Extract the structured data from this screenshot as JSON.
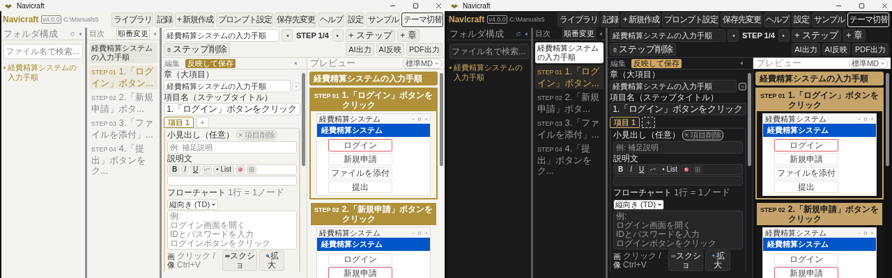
{
  "windows": [
    {
      "kind": "light",
      "title": "Navicraft",
      "app": {
        "brand": "Navicraft",
        "version": "v4.0.0",
        "path": "C:\\Manuals5"
      },
      "header_buttons": [
        {
          "label": "ライブラリ",
          "outlined": false
        },
        {
          "label": "記録",
          "outlined": false
        },
        {
          "label": "+ 新規作成",
          "outlined": false
        },
        {
          "label": "プロンプト設定",
          "outlined": false
        },
        {
          "label": "保存先変更",
          "outlined": false
        },
        {
          "label": "ヘルプ",
          "outlined": false
        },
        {
          "label": "設定",
          "outlined": false
        },
        {
          "label": "サンプル",
          "outlined": false
        },
        {
          "label": "テーマ切替",
          "outlined": true
        }
      ],
      "folder_panel": {
        "title": "フォルダ構成",
        "search": {
          "placeholder": "ファイル名で検索..."
        },
        "items": [
          "経費精算システムの入力手順"
        ]
      },
      "toc": {
        "title": "目次",
        "reorder_button": "順番変更",
        "items": [
          {
            "kind": "chapter",
            "label": "経費精算システムの入力手順",
            "selected": true
          },
          {
            "kind": "step",
            "step": "STEP 01",
            "label": "1.「ログイン」ボタン...",
            "selected": true
          },
          {
            "kind": "step",
            "step": "STEP 02",
            "label": "2.「新規申請」ボタ...",
            "selected": false
          },
          {
            "kind": "step",
            "step": "STEP 03",
            "label": "3.「ファイルを添付」...",
            "selected": false
          },
          {
            "kind": "step",
            "step": "STEP 04",
            "label": "4.「提出」ボタンをク...",
            "selected": false
          }
        ]
      },
      "toolbar": {
        "document_field": {
          "value": "経費精算システムの入力手順"
        },
        "step_indicator": "STEP 1/4",
        "actions": [
          {
            "kind": "add",
            "label": "+ ステップ"
          },
          {
            "kind": "add",
            "label": "+ 章"
          },
          {
            "kind": "delete",
            "label": "ステップ削除"
          }
        ],
        "export_actions": [
          "AI出力",
          "AI反映",
          "PDF出力"
        ]
      },
      "editor": {
        "title": "編集",
        "save_button": "反映して保存",
        "chapter_label": "章（大項目）",
        "chapter_field": {
          "value": "経費精算システムの入力手順"
        },
        "title_label": "項目名（ステップタイトル）",
        "title_field": {
          "value": "1.「ログイン」ボタンをクリック"
        },
        "tabs": [
          {
            "label": "項目 1",
            "selected": true
          }
        ],
        "add_tab": "+",
        "item": {
          "subheading_label": "小見出し（任意）",
          "delete_button": "× 項目削除",
          "subheading_field": {
            "placeholder": "例: 補足説明"
          },
          "description_label": "説明文",
          "format_buttons": [
            {
              "kind": "bold",
              "label": "B"
            },
            {
              "kind": "italic",
              "label": "I"
            },
            {
              "kind": "underline",
              "label": "U"
            },
            {
              "kind": "link"
            },
            {
              "kind": "list",
              "label": "• List"
            },
            {
              "kind": "color"
            },
            {
              "kind": "table"
            }
          ],
          "flowchart_label": "フローチャート",
          "flowchart_hint": "1行 = 1ノード",
          "direction_select": "縦向き (TD)",
          "flowchart_field": {
            "placeholder_lines": [
              "例:",
              "ログイン画面を開く",
              "IDとパスワードを入力",
              "ログインボタンをクリック"
            ]
          },
          "image_label": "画像",
          "paste_hint": "クリック / Ctrl+V",
          "screenshot_button": "スクショ",
          "zoom_button": "拡大"
        }
      },
      "preview": {
        "title": "プレビュー",
        "style_select": "標準MD",
        "chapter_title": "経費精算システムの入力手順",
        "steps": [
          {
            "step": "STEP 01",
            "title": "1.「ログイン」ボタンをクリック",
            "selected": true,
            "screenshot": {
              "window_title": "経費精算システム",
              "app_title": "経費精算システム",
              "buttons": [
                {
                  "label": "ログイン",
                  "highlighted": true
                },
                {
                  "label": "新規申請",
                  "highlighted": false
                },
                {
                  "label": "ファイルを添付",
                  "highlighted": false
                },
                {
                  "label": "提出",
                  "highlighted": false
                }
              ]
            }
          },
          {
            "step": "STEP 02",
            "title": "2.「新規申請」ボタンをクリック",
            "selected": false,
            "screenshot": {
              "window_title": "経費精算システム",
              "app_title": "経費精算システム",
              "buttons": [
                {
                  "label": "ログイン",
                  "highlighted": false
                },
                {
                  "label": "新規申請",
                  "highlighted": true
                }
              ]
            }
          }
        ]
      }
    },
    {
      "kind": "dark",
      "title": "Navicraft",
      "app": {
        "brand": "Navicraft",
        "version": "v4.0.0",
        "path": "C:\\Manuals5"
      },
      "header_buttons": [
        {
          "label": "ライブラリ",
          "outlined": false
        },
        {
          "label": "記録",
          "outlined": false
        },
        {
          "label": "+ 新規作成",
          "outlined": false
        },
        {
          "label": "プロンプト設定",
          "outlined": false
        },
        {
          "label": "保存先変更",
          "outlined": false
        },
        {
          "label": "ヘルプ",
          "outlined": false
        },
        {
          "label": "設定",
          "outlined": false
        },
        {
          "label": "サンプル",
          "outlined": false
        },
        {
          "label": "テーマ切替",
          "outlined": true
        }
      ],
      "folder_panel": {
        "title": "フォルダ構成",
        "search": {
          "placeholder": "ファイル名で検索..."
        },
        "items": [
          "経費精算システムの入力手順"
        ]
      },
      "toc": {
        "title": "目次",
        "reorder_button": "順番変更",
        "items": [
          {
            "kind": "chapter",
            "label": "経費精算システムの入力手順",
            "selected": true
          },
          {
            "kind": "step",
            "step": "STEP 01",
            "label": "1.「ログイン」ボタン...",
            "selected": true
          },
          {
            "kind": "step",
            "step": "STEP 02",
            "label": "2.「新規申請」ボタ...",
            "selected": false
          },
          {
            "kind": "step",
            "step": "STEP 03",
            "label": "3.「ファイルを添付」...",
            "selected": false
          },
          {
            "kind": "step",
            "step": "STEP 04",
            "label": "4.「提出」ボタンをク...",
            "selected": false
          }
        ]
      },
      "toolbar": {
        "document_field": {
          "value": "経費精算システムの入力手順"
        },
        "step_indicator": "STEP 1/4",
        "actions": [
          {
            "kind": "add",
            "label": "+ ステップ"
          },
          {
            "kind": "add",
            "label": "+ 章"
          },
          {
            "kind": "delete",
            "label": "ステップ削除"
          }
        ],
        "export_actions": [
          "AI出力",
          "AI反映",
          "PDF出力"
        ]
      },
      "editor": {
        "title": "編集",
        "save_button": "反映して保存",
        "chapter_label": "章（大項目）",
        "chapter_field": {
          "value": "経費精算システムの入力手順"
        },
        "title_label": "項目名（ステップタイトル）",
        "title_field": {
          "value": "1.「ログイン」ボタンをクリック"
        },
        "tabs": [
          {
            "label": "項目 1",
            "selected": true
          }
        ],
        "add_tab": "+",
        "item": {
          "subheading_label": "小見出し（任意）",
          "delete_button": "× 項目削除",
          "subheading_field": {
            "placeholder": "例: 補足説明"
          },
          "description_label": "説明文",
          "format_buttons": [
            {
              "kind": "bold",
              "label": "B"
            },
            {
              "kind": "italic",
              "label": "I"
            },
            {
              "kind": "underline",
              "label": "U"
            },
            {
              "kind": "link"
            },
            {
              "kind": "list",
              "label": "• List"
            },
            {
              "kind": "color"
            },
            {
              "kind": "table"
            }
          ],
          "flowchart_label": "フローチャート",
          "flowchart_hint": "1行 = 1ノード",
          "direction_select": "縦向き (TD)",
          "flowchart_field": {
            "placeholder_lines": [
              "例:",
              "ログイン画面を開く",
              "IDとパスワードを入力",
              "ログインボタンをクリック"
            ]
          },
          "image_label": "画像",
          "paste_hint": "クリック / Ctrl+V",
          "screenshot_button": "スクショ",
          "zoom_button": "拡大"
        }
      },
      "preview": {
        "title": "プレビュー",
        "style_select": "標準MD",
        "chapter_title": "経費精算システムの入力手順",
        "steps": [
          {
            "step": "STEP 01",
            "title": "1.「ログイン」ボタンをクリック",
            "selected": true,
            "screenshot": {
              "window_title": "経費精算システム",
              "app_title": "経費精算システム",
              "buttons": [
                {
                  "label": "ログイン",
                  "highlighted": true
                },
                {
                  "label": "新規申請",
                  "highlighted": false
                },
                {
                  "label": "ファイルを添付",
                  "highlighted": false
                },
                {
                  "label": "提出",
                  "highlighted": false
                }
              ]
            }
          },
          {
            "step": "STEP 02",
            "title": "2.「新規申請」ボタンをクリック",
            "selected": false,
            "screenshot": {
              "window_title": "経費精算システム",
              "app_title": "経費精算システム",
              "buttons": [
                {
                  "label": "ログイン",
                  "highlighted": false
                },
                {
                  "label": "新規申請",
                  "highlighted": true
                }
              ]
            }
          }
        ]
      }
    }
  ]
}
